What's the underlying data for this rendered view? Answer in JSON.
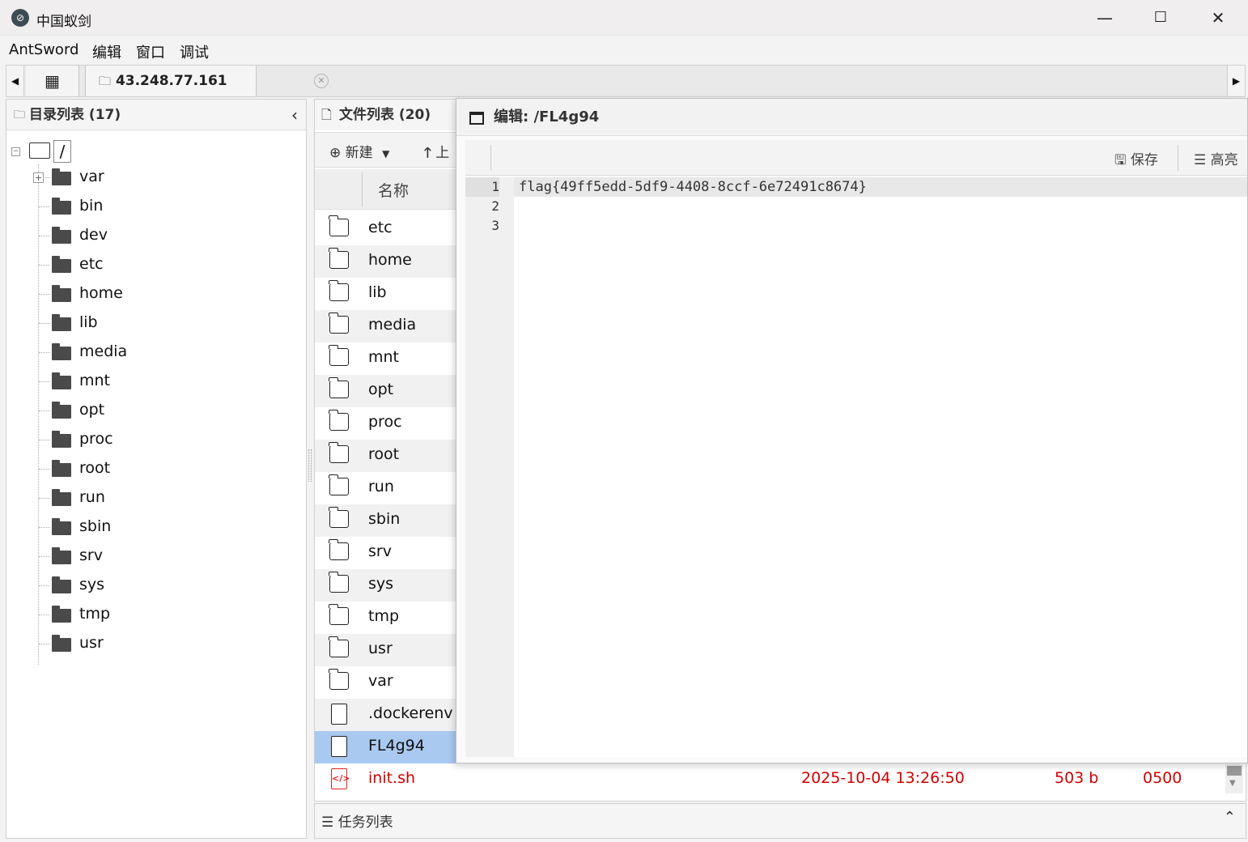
{
  "window": {
    "title": "中国蚁剑",
    "minimize": "—",
    "maximize": "☐",
    "close": "✕"
  },
  "menu": {
    "items": [
      "AntSword",
      "编辑",
      "窗口",
      "调试"
    ]
  },
  "tabs": {
    "host": "43.248.77.161",
    "close": "✕",
    "left_arrow": "◀",
    "right_arrow": "▶",
    "grid": "▦"
  },
  "dir_panel": {
    "title": "目录列表 (17)",
    "root": "/",
    "collapse": "‹",
    "items": [
      "var",
      "bin",
      "dev",
      "etc",
      "home",
      "lib",
      "media",
      "mnt",
      "opt",
      "proc",
      "root",
      "run",
      "sbin",
      "srv",
      "sys",
      "tmp",
      "usr"
    ]
  },
  "file_panel": {
    "title": "文件列表 (20)",
    "new_label": "新建",
    "up_label": "上",
    "col_name": "名称",
    "rows": [
      {
        "name": "etc",
        "type": "dir"
      },
      {
        "name": "home",
        "type": "dir"
      },
      {
        "name": "lib",
        "type": "dir"
      },
      {
        "name": "media",
        "type": "dir"
      },
      {
        "name": "mnt",
        "type": "dir"
      },
      {
        "name": "opt",
        "type": "dir"
      },
      {
        "name": "proc",
        "type": "dir"
      },
      {
        "name": "root",
        "type": "dir"
      },
      {
        "name": "run",
        "type": "dir"
      },
      {
        "name": "sbin",
        "type": "dir"
      },
      {
        "name": "srv",
        "type": "dir"
      },
      {
        "name": "sys",
        "type": "dir"
      },
      {
        "name": "tmp",
        "type": "dir"
      },
      {
        "name": "usr",
        "type": "dir"
      },
      {
        "name": "var",
        "type": "dir"
      },
      {
        "name": ".dockerenv",
        "type": "file"
      },
      {
        "name": "FL4g94",
        "type": "file",
        "selected": true
      },
      {
        "name": "init.sh",
        "type": "script",
        "time": "2025-10-04 13:26:50",
        "size": "503 b",
        "perm": "0500"
      }
    ]
  },
  "task_bar": {
    "label": "任务列表",
    "toggle": "⌃"
  },
  "editor": {
    "title": "编辑: /FL4g94",
    "save": "保存",
    "highlight": "高亮",
    "lines": [
      "flag{49ff5edd-5df9-4408-8ccf-6e72491c8674}",
      "",
      ""
    ],
    "line_numbers": [
      "1",
      "2",
      "3"
    ]
  },
  "colors": {
    "selected_row": "#a9c9f0",
    "script_red": "#d20000"
  }
}
